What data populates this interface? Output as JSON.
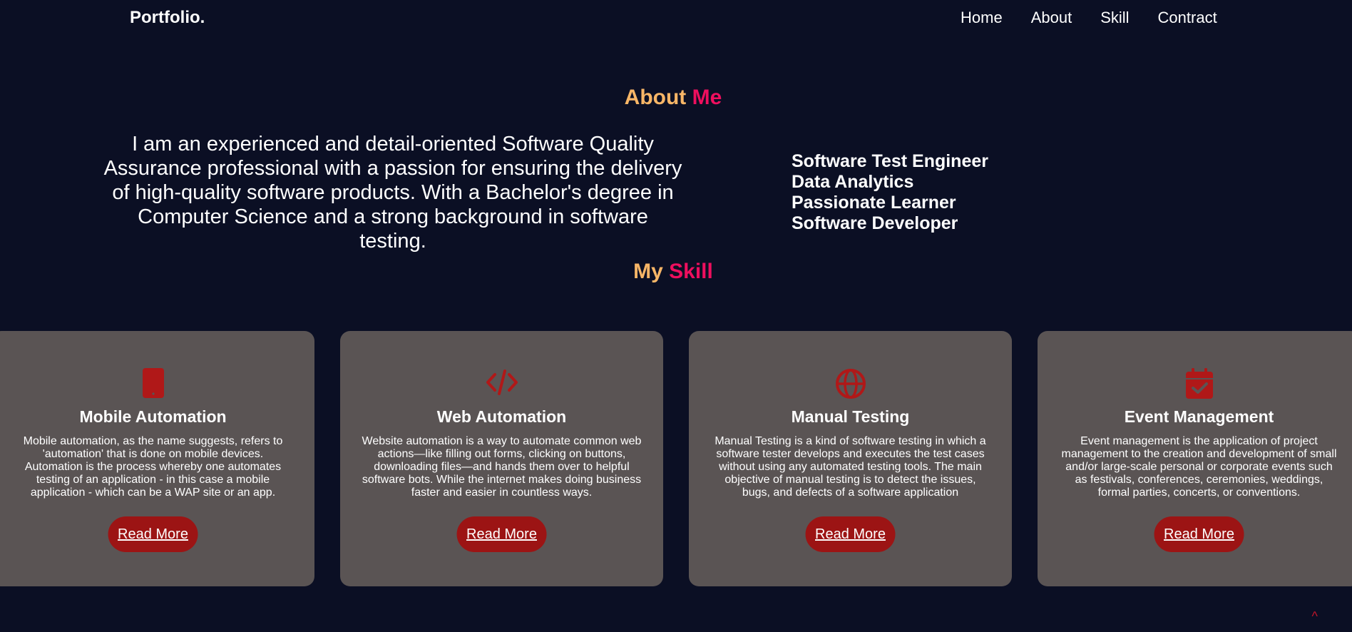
{
  "header": {
    "logo": "Portfolio.",
    "nav": [
      "Home",
      "About",
      "Skill",
      "Contract"
    ]
  },
  "about": {
    "title_part1": "About",
    "title_part2": "Me",
    "text": "I am an experienced and detail-oriented Software Quality Assurance professional with a passion for ensuring the delivery of high-quality software products. With a Bachelor's degree in Computer Science and a strong background in software testing.",
    "roles": [
      "Software Test Engineer",
      "Data Analytics",
      "Passionate Learner",
      "Software Developer"
    ]
  },
  "skills": {
    "title_part1": "My",
    "title_part2": "Skill",
    "cards": [
      {
        "icon": "mobile-icon",
        "title": "Mobile Automation",
        "desc": "Mobile automation, as the name suggests, refers to 'automation' that is done on mobile devices. Automation is the process whereby one automates testing of an application - in this case a mobile application - which can be a WAP site or an app.",
        "button": "Read More"
      },
      {
        "icon": "code-icon",
        "title": "Web Automation",
        "desc": "Website automation is a way to automate common web actions—like filling out forms, clicking on buttons, downloading files—and hands them over to helpful software bots. While the internet makes doing business faster and easier in countless ways.",
        "button": "Read More"
      },
      {
        "icon": "globe-icon",
        "title": "Manual Testing",
        "desc": "Manual Testing is a kind of software testing in which a software tester develops and executes the test cases without using any automated testing tools. The main objective of manual testing is to detect the issues, bugs, and defects of a software application",
        "button": "Read More"
      },
      {
        "icon": "calendar-check-icon",
        "title": "Event Management",
        "desc": "Event management is the application of project management to the creation and development of small and/or large-scale personal or corporate events such as festivals, conferences, ceremonies, weddings, formal parties, concerts, or conventions.",
        "button": "Read More"
      }
    ]
  },
  "scroll_top": "^",
  "colors": {
    "background": "#0b0f24",
    "card": "#5a5454",
    "accent_orange": "#f8b667",
    "accent_pink": "#ee0f5e",
    "button": "#9c1414",
    "icon": "#b01818"
  }
}
